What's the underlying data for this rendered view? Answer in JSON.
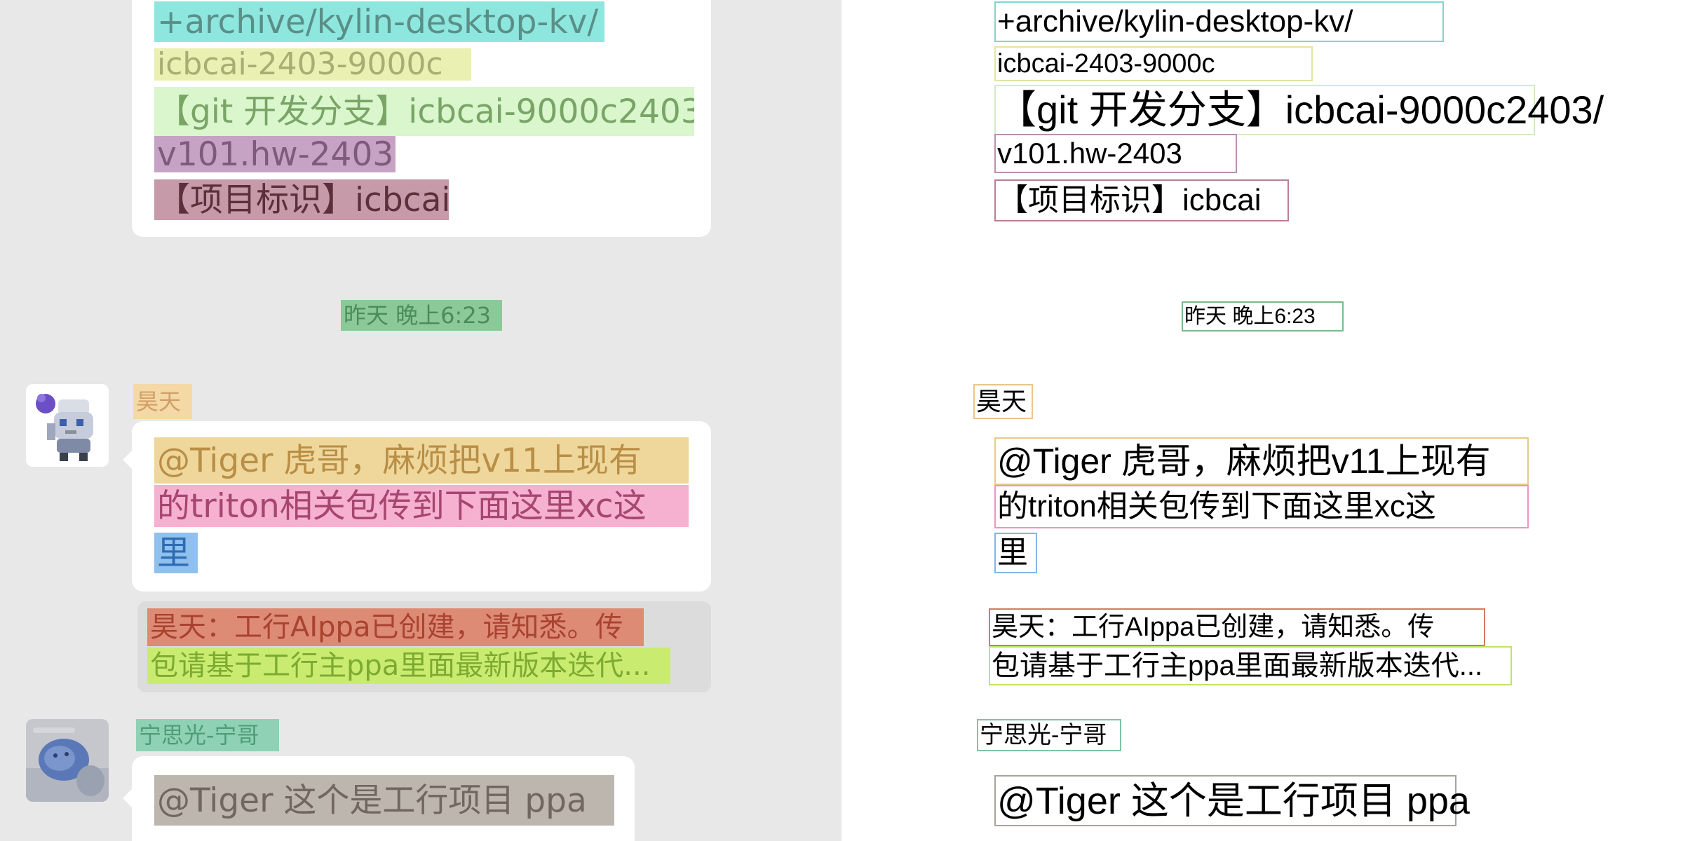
{
  "messages": [
    {
      "lines": [
        "+archive/kylin-desktop-kv/",
        "icbcai-2403-9000c",
        "【git 开发分支】icbcai-9000c2403/",
        "v101.hw-2403",
        "【项目标识】icbcai"
      ]
    },
    {
      "sender": "昊天",
      "lines": [
        "@Tiger 虎哥，麻烦把v11上现有",
        "的triton相关包传到下面这里xc这",
        "里"
      ],
      "quote_lines": [
        "昊天：工行AIppa已创建，请知悉。传",
        "包请基于工行主ppa里面最新版本迭代..."
      ]
    },
    {
      "sender": "宁思光-宁哥",
      "lines": [
        "@Tiger 这个是工行项目 ppa"
      ]
    }
  ],
  "divider": {
    "timestamp": "昨天 晚上6:23"
  }
}
